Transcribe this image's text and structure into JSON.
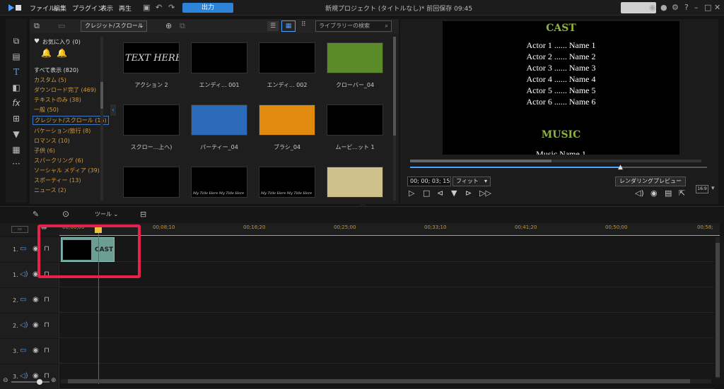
{
  "menu": [
    "ファイル",
    "編集",
    "プラグイン",
    "表示",
    "再生"
  ],
  "export_label": "出力",
  "project_title": "新規プロジェクト (タイトルなし)* 前回保存 09:45",
  "library": {
    "category_dropdown": "クレジット/スクロール",
    "search_placeholder": "ライブラリーの検索",
    "categories": [
      {
        "label": "お気に入り (0)",
        "style": "white"
      },
      {
        "label": "すべて表示 (820)",
        "style": "white"
      },
      {
        "label": "カスタム (5)",
        "style": "orange"
      },
      {
        "label": "ダウンロード完了 (469)",
        "style": "orange"
      },
      {
        "label": "テキストのみ (38)",
        "style": "orange"
      },
      {
        "label": "一般 (50)",
        "style": "orange"
      },
      {
        "label": "クレジット/スクロール (15)",
        "style": "selected"
      },
      {
        "label": "バケーション/旅行 (8)",
        "style": "orange"
      },
      {
        "label": "ロマンス (10)",
        "style": "orange"
      },
      {
        "label": "子供 (6)",
        "style": "orange"
      },
      {
        "label": "スパークリング (6)",
        "style": "orange"
      },
      {
        "label": "ソーシャル メディア (39)",
        "style": "orange"
      },
      {
        "label": "スポーティー (13)",
        "style": "orange"
      },
      {
        "label": "ニュース (2)",
        "style": "orange"
      }
    ],
    "items": [
      {
        "label": "アクション 2",
        "thumb_text": "TEXT HERE"
      },
      {
        "label": "エンディ... 001",
        "thumb_text": ""
      },
      {
        "label": "エンディ... 002",
        "thumb_text": ""
      },
      {
        "label": "クローバー_04",
        "thumb_text": ""
      },
      {
        "label": "スクロー...上へ)",
        "thumb_text": ""
      },
      {
        "label": "パーティー_04",
        "thumb_text": ""
      },
      {
        "label": "ブラシ_04",
        "thumb_text": ""
      },
      {
        "label": "ムービ...ット 1",
        "thumb_text": ""
      },
      {
        "label": "",
        "thumb_text": ""
      },
      {
        "label": "",
        "thumb_text": "My Title Here My Title Here"
      },
      {
        "label": "",
        "thumb_text": "My Title Here My Title Here"
      },
      {
        "label": "",
        "thumb_text": ""
      }
    ]
  },
  "preview": {
    "heading_cast": "CAST",
    "actors": [
      "Actor 1 ...... Name 1",
      "Actor 2 ...... Name 2",
      "Actor 3 ...... Name 3",
      "Actor 4 ...... Name 4",
      "Actor 5 ...... Name 5",
      "Actor 6 ...... Name 6"
    ],
    "heading_music": "MUSIC",
    "music_line": "Music Name 1",
    "timecode": "00; 00; 03; 15",
    "fit_label": "フィット",
    "render_label": "レンダリングプレビュー",
    "aspect": "16:9"
  },
  "timeline": {
    "tool_label": "ツール",
    "ruler": [
      "00;00;00",
      "00;08;10",
      "00;16;20",
      "00;25;00",
      "00;33;10",
      "00;41;20",
      "00;50;00",
      "00;58;"
    ],
    "tracks": [
      {
        "num": "1.",
        "type": "video"
      },
      {
        "num": "1.",
        "type": "audio"
      },
      {
        "num": "2.",
        "type": "video"
      },
      {
        "num": "2.",
        "type": "audio"
      },
      {
        "num": "3.",
        "type": "video"
      },
      {
        "num": "3.",
        "type": "audio"
      }
    ],
    "clip_label": "CAST"
  },
  "colors": {
    "accent": "#2c83d8",
    "highlight": "#e8214b",
    "cast_green": "#8fb339"
  }
}
